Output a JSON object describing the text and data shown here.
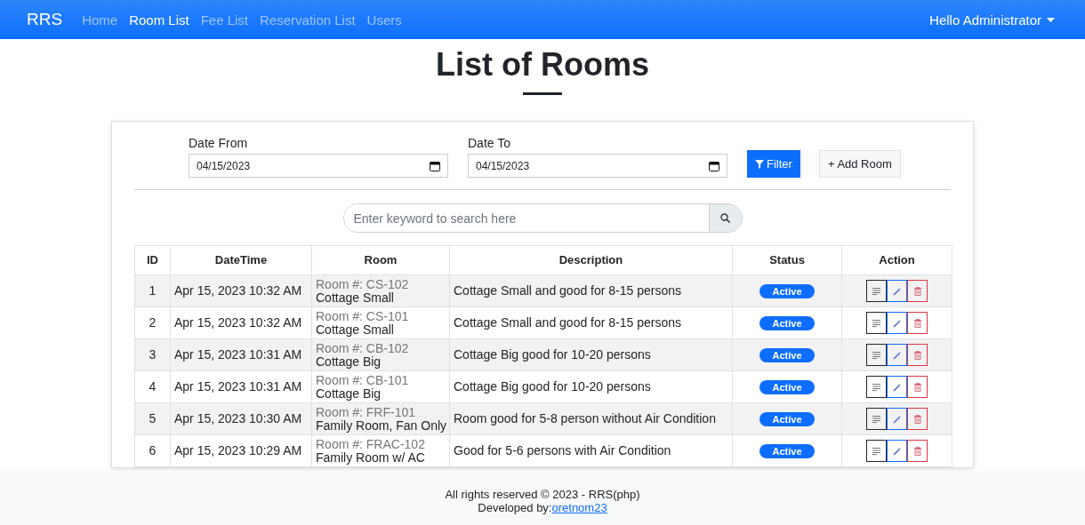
{
  "navbar": {
    "brand": "RRS",
    "links": [
      {
        "label": "Home",
        "selected": false
      },
      {
        "label": "Room List",
        "selected": true
      },
      {
        "label": "Fee List",
        "selected": false
      },
      {
        "label": "Reservation List",
        "selected": false
      },
      {
        "label": "Users",
        "selected": false
      }
    ],
    "user_menu": "Hello Administrator"
  },
  "page_title": "List of Rooms",
  "filters": {
    "date_from": {
      "label": "Date From",
      "value": "04/15/2023"
    },
    "date_to": {
      "label": "Date To",
      "value": "04/15/2023"
    },
    "filter_button": "Filter",
    "add_button": "+ Add Room"
  },
  "search": {
    "placeholder": "Enter keyword to search here"
  },
  "table": {
    "columns": [
      "ID",
      "DateTime",
      "Room",
      "Description",
      "Status",
      "Action"
    ],
    "rows": [
      {
        "id": "1",
        "datetime": "Apr 15, 2023 10:32 AM",
        "room_no": "Room #: CS-102",
        "room_name": "Cottage Small",
        "description": "Cottage Small and good for 8-15 persons",
        "status": "Active"
      },
      {
        "id": "2",
        "datetime": "Apr 15, 2023 10:32 AM",
        "room_no": "Room #: CS-101",
        "room_name": "Cottage Small",
        "description": "Cottage Small and good for 8-15 persons",
        "status": "Active"
      },
      {
        "id": "3",
        "datetime": "Apr 15, 2023 10:31 AM",
        "room_no": "Room #: CB-102",
        "room_name": "Cottage Big",
        "description": "Cottage Big good for 10-20 persons",
        "status": "Active"
      },
      {
        "id": "4",
        "datetime": "Apr 15, 2023 10:31 AM",
        "room_no": "Room #: CB-101",
        "room_name": "Cottage Big",
        "description": "Cottage Big good for 10-20 persons",
        "status": "Active"
      },
      {
        "id": "5",
        "datetime": "Apr 15, 2023 10:30 AM",
        "room_no": "Room #: FRF-101",
        "room_name": "Family Room, Fan Only",
        "description": "Room good for 5-8 person without Air Condition",
        "status": "Active"
      },
      {
        "id": "6",
        "datetime": "Apr 15, 2023 10:29 AM",
        "room_no": "Room #: FRAC-102",
        "room_name": "Family Room w/ AC",
        "description": "Good for 5-6 persons with Air Condition",
        "status": "Active"
      }
    ]
  },
  "footer": {
    "copyright": "All rights reserved © 2023 - RRS(php)",
    "developed_by": "Developed by:",
    "author_link": "oretnom23"
  }
}
